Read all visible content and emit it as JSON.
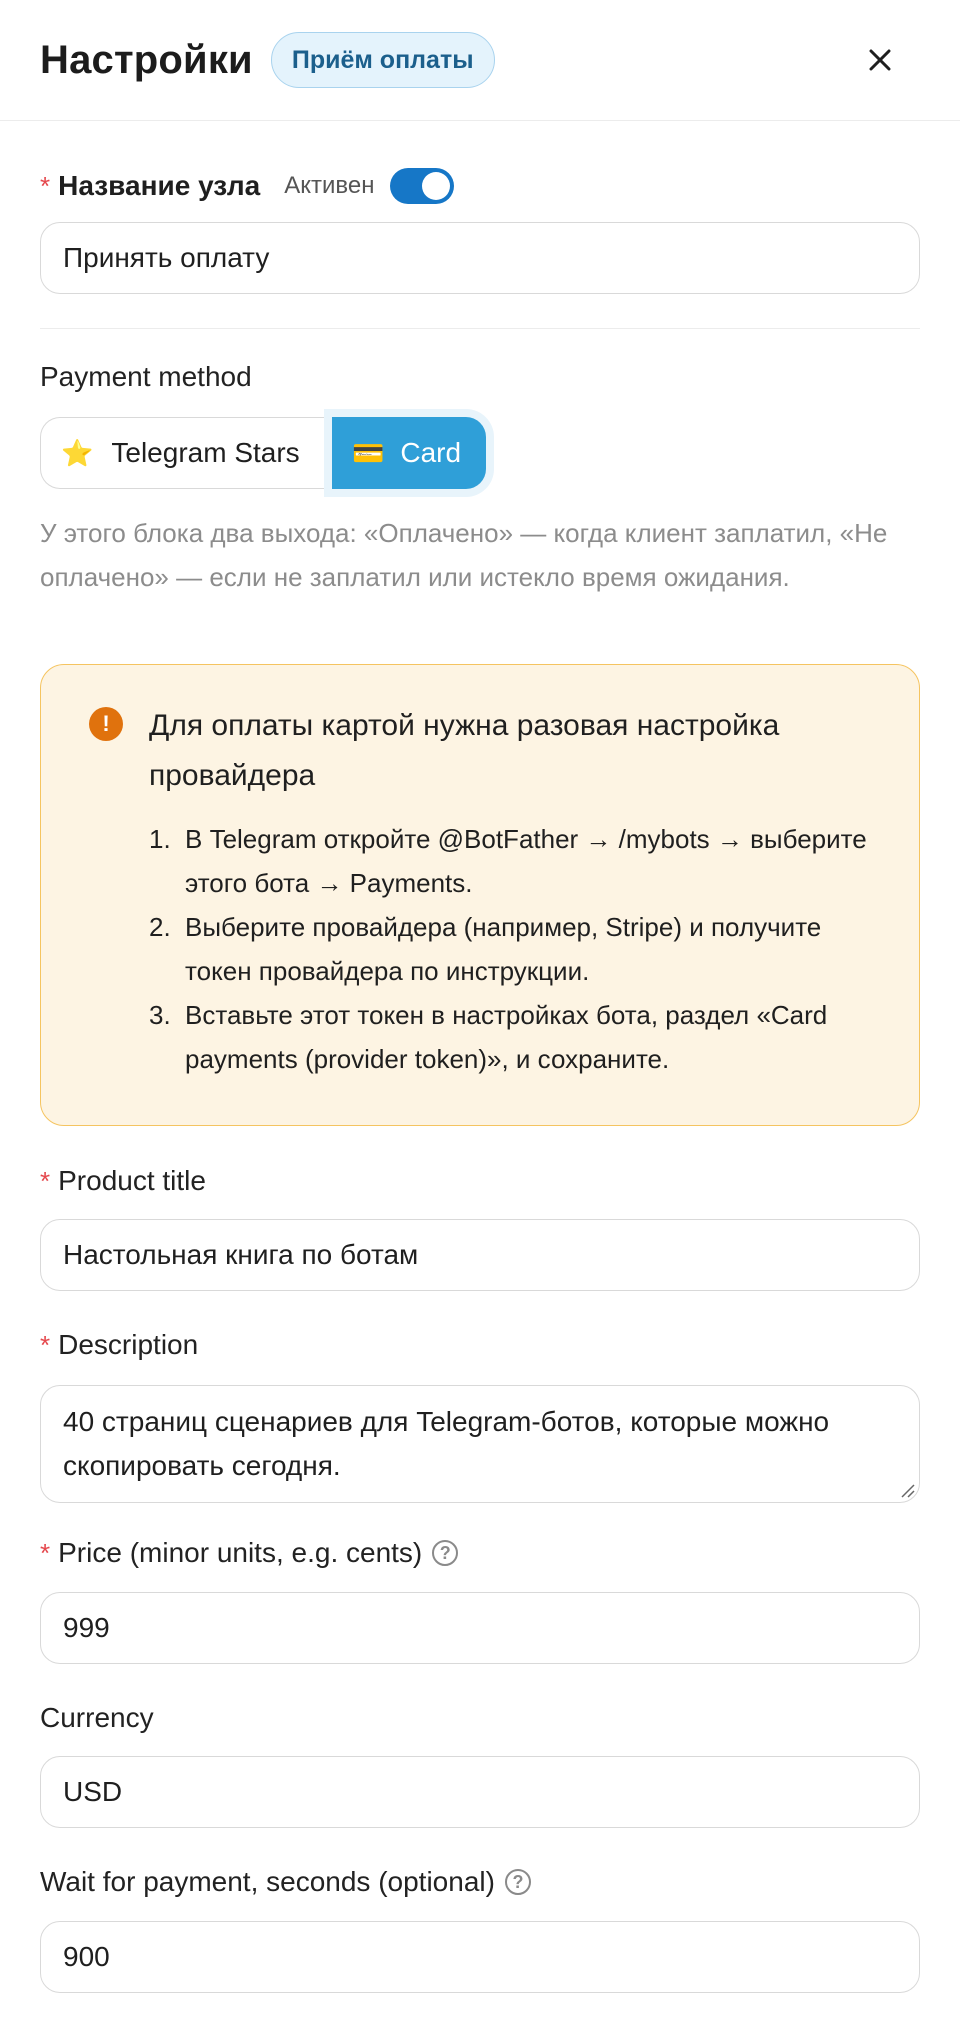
{
  "header": {
    "title": "Настройки",
    "tag": "Приём оплаты"
  },
  "node": {
    "label": "Название узла",
    "active_label": "Активен",
    "active": true,
    "value": "Принять оплату"
  },
  "payment": {
    "label": "Payment method",
    "options": [
      {
        "icon": "star-icon",
        "glyph": "⭐",
        "label": "Telegram Stars",
        "selected": false
      },
      {
        "icon": "credit-card-icon",
        "glyph": "💳",
        "label": "Card",
        "selected": true
      }
    ],
    "hint": "У этого блока два выхода: «Оплачено» — когда клиент заплатил, «Не оплачено» — если не заплатил или истекло время ожидания."
  },
  "warning": {
    "title": "Для оплаты картой нужна разовая настройка провайдера",
    "steps": [
      "В Telegram откройте @BotFather → /mybots → выберите этого бота → Payments.",
      "Выберите провайдера (например, Stripe) и получите токен провайдера по инструкции.",
      "Вставьте этот токен в настройках бота, раздел «Card payments (provider token)», и сохраните."
    ]
  },
  "fields": {
    "product_title": {
      "label": "Product title",
      "value": "Настольная книга по ботам"
    },
    "description": {
      "label": "Description",
      "value": "40 страниц сценариев для Telegram-ботов, которые можно скопировать сегодня."
    },
    "price": {
      "label": "Price (minor units, e.g. cents)",
      "value": "999"
    },
    "currency": {
      "label": "Currency",
      "value": "USD"
    },
    "wait": {
      "label": "Wait for payment, seconds (optional)",
      "value": "900"
    }
  },
  "colors": {
    "accent": "#2f9fd8",
    "toggle": "#1677c7",
    "warning_bg": "#fdf4e3",
    "warning_border": "#f5c460",
    "warning_icon": "#e0720d",
    "required": "#e5484d"
  }
}
